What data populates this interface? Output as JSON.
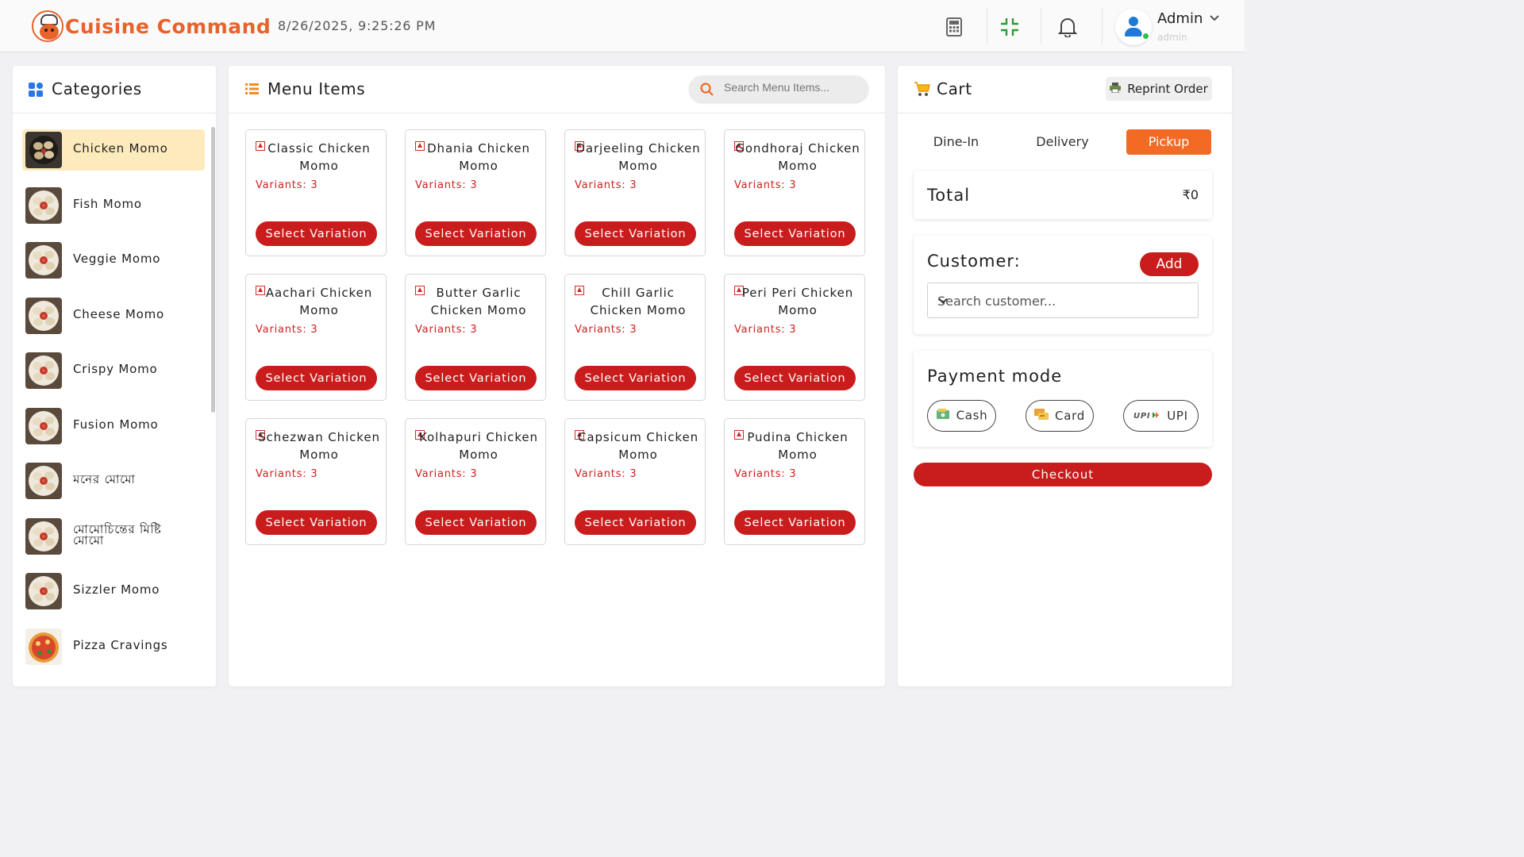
{
  "header": {
    "app_title": "Cuisine Command",
    "datetime": "8/26/2025, 9:25:26 PM",
    "user_name": "Admin",
    "user_role": "admin",
    "icons": [
      "calculator-icon",
      "compress-icon",
      "bell-icon",
      "user-avatar",
      "chevron-down-icon"
    ]
  },
  "categories": {
    "title": "Categories",
    "items": [
      {
        "label": "Chicken Momo",
        "active": true
      },
      {
        "label": "Fish Momo"
      },
      {
        "label": "Veggie Momo"
      },
      {
        "label": "Cheese Momo"
      },
      {
        "label": "Crispy Momo"
      },
      {
        "label": "Fusion Momo"
      },
      {
        "label": "মনের মোমো"
      },
      {
        "label": "মোমোচিন্তের মিষ্টি মোমো"
      },
      {
        "label": "Sizzler Momo"
      },
      {
        "label": "Pizza Cravings"
      }
    ]
  },
  "menu": {
    "title": "Menu Items",
    "search_placeholder": "Search Menu Items...",
    "button_label": "Select Variation",
    "items": [
      {
        "name": "Classic Chicken Momo",
        "variants": "Variants: 3"
      },
      {
        "name": "Dhania Chicken Momo",
        "variants": "Variants: 3"
      },
      {
        "name": "Darjeeling Chicken Momo",
        "variants": "Variants: 3"
      },
      {
        "name": "Gondhoraj Chicken Momo",
        "variants": "Variants: 3"
      },
      {
        "name": "Aachari Chicken Momo",
        "variants": "Variants: 3"
      },
      {
        "name": "Butter Garlic Chicken Momo",
        "variants": "Variants: 3"
      },
      {
        "name": "Chill Garlic Chicken Momo",
        "variants": "Variants: 3"
      },
      {
        "name": "Peri Peri Chicken Momo",
        "variants": "Variants: 3"
      },
      {
        "name": "Schezwan Chicken Momo",
        "variants": "Variants: 3"
      },
      {
        "name": "Kolhapuri Chicken Momo",
        "variants": "Variants: 3"
      },
      {
        "name": "Capsicum Chicken Momo",
        "variants": "Variants: 3"
      },
      {
        "name": "Pudina Chicken Momo",
        "variants": "Variants: 3"
      }
    ]
  },
  "cart": {
    "title": "Cart",
    "reprint_label": "Reprint Order",
    "tabs": [
      {
        "label": "Dine-In"
      },
      {
        "label": "Delivery"
      },
      {
        "label": "Pickup",
        "active": true
      }
    ],
    "total_label": "Total",
    "total_value": "₹0",
    "customer_label": "Customer:",
    "add_label": "Add",
    "customer_placeholder": "Search customer...",
    "payment_label": "Payment mode",
    "payment_options": [
      {
        "label": "Cash",
        "icon": "cash-icon"
      },
      {
        "label": "Card",
        "icon": "card-icon"
      },
      {
        "label": "UPI",
        "icon": "upi-icon"
      }
    ],
    "checkout_label": "Checkout"
  },
  "colors": {
    "brand": "#e8622c",
    "primary_button": "#c91c1c",
    "active_tab": "#f26a24",
    "active_category": "#fdebbd"
  }
}
